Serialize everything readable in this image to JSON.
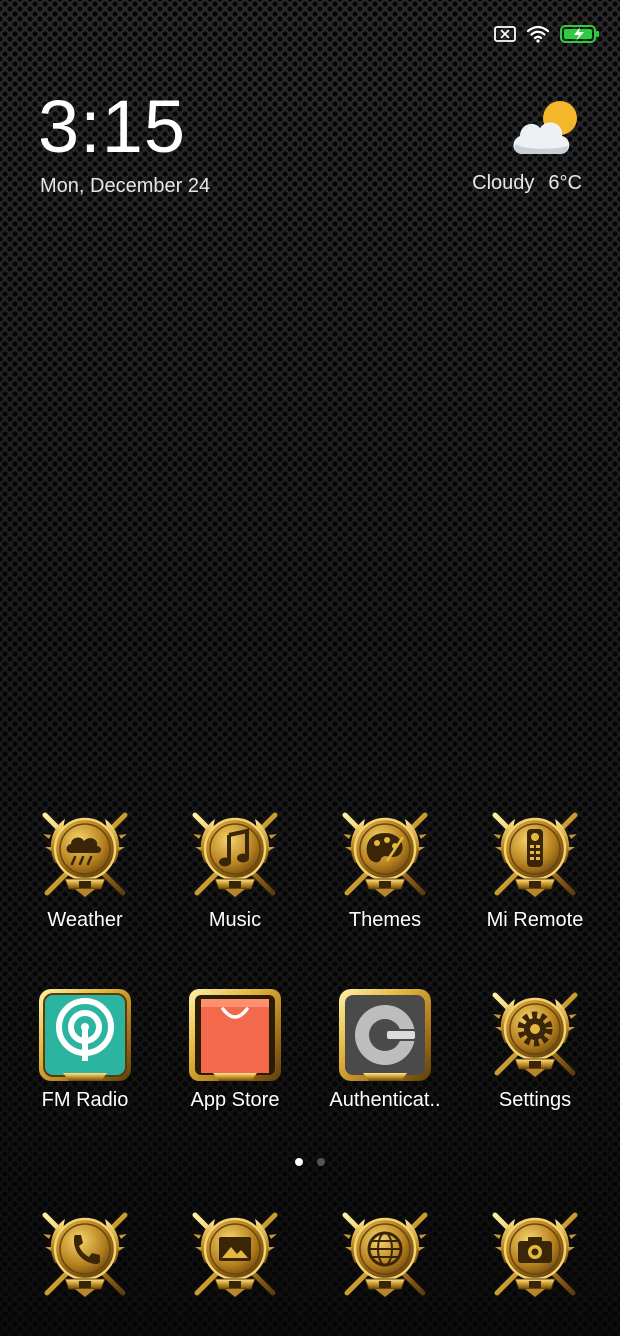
{
  "status_bar": {
    "icons": [
      "sim-off-icon",
      "wifi-icon",
      "battery-charging-icon"
    ],
    "battery_color": "#2ecc40"
  },
  "clock": {
    "time": "3:15",
    "date": "Mon, December 24"
  },
  "weather": {
    "condition": "Cloudy",
    "temperature": "6°C",
    "icon": "partly-cloudy-icon"
  },
  "home_rows": [
    [
      {
        "label": "Weather",
        "icon": "weather-rain-emblem-icon"
      },
      {
        "label": "Music",
        "icon": "music-note-emblem-icon"
      },
      {
        "label": "Themes",
        "icon": "palette-emblem-icon"
      },
      {
        "label": "Mi Remote",
        "icon": "remote-control-emblem-icon"
      }
    ],
    [
      {
        "label": "FM Radio",
        "icon": "radio-signal-icon"
      },
      {
        "label": "App Store",
        "icon": "shopping-bag-icon"
      },
      {
        "label": "Authenticat..",
        "icon": "google-authenticator-icon"
      },
      {
        "label": "Settings",
        "icon": "gear-emblem-icon"
      }
    ]
  ],
  "page_indicator": {
    "pages": 2,
    "current": 1
  },
  "dock": [
    {
      "icon": "phone-emblem-icon"
    },
    {
      "icon": "gallery-emblem-icon"
    },
    {
      "icon": "browser-www-emblem-icon"
    },
    {
      "icon": "camera-emblem-icon"
    }
  ],
  "colors": {
    "gold": "#d4a72c",
    "gold_dark": "#7a5410",
    "fm_teal": "#2bb5a0",
    "store_orange": "#f26a4b"
  }
}
